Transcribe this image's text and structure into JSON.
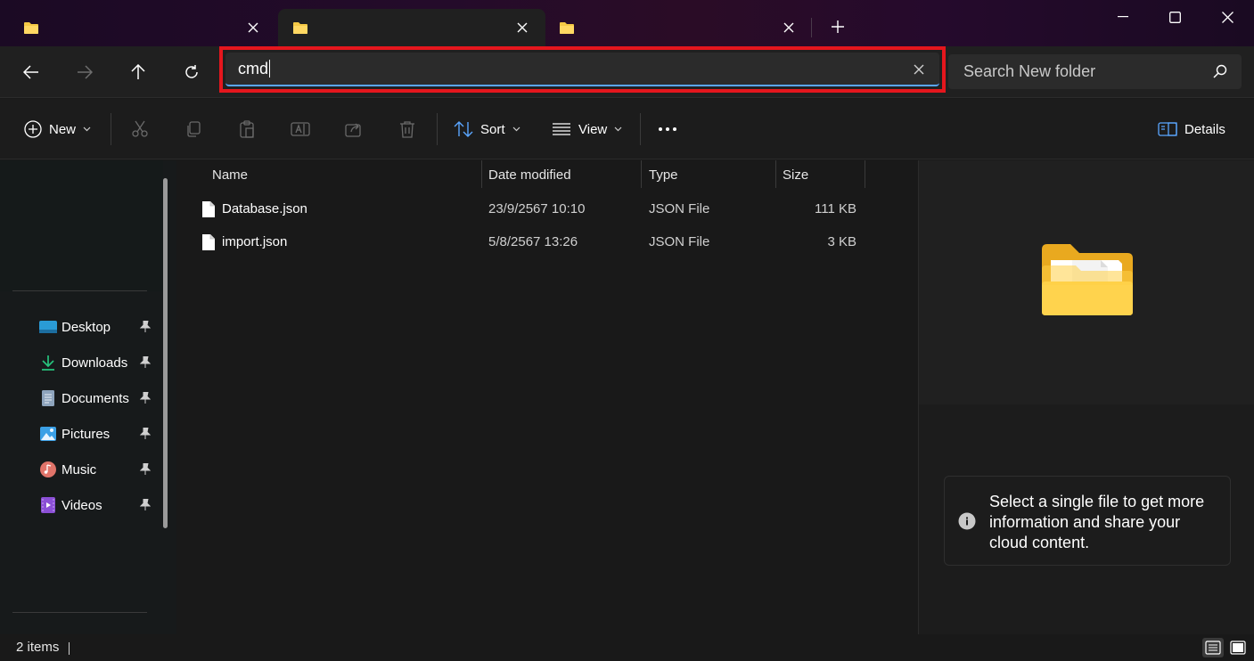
{
  "tabs": [
    {
      "icon": "folder-icon",
      "label": ""
    },
    {
      "icon": "folder-icon",
      "label": ""
    },
    {
      "icon": "folder-icon",
      "label": ""
    }
  ],
  "address": {
    "value": "cmd"
  },
  "search": {
    "placeholder": "Search New folder"
  },
  "toolbar": {
    "new_label": "New",
    "sort_label": "Sort",
    "view_label": "View",
    "details_label": "Details"
  },
  "sidebar": {
    "items": [
      {
        "label": "Desktop",
        "icon": "desktop-icon"
      },
      {
        "label": "Downloads",
        "icon": "downloads-icon"
      },
      {
        "label": "Documents",
        "icon": "documents-icon"
      },
      {
        "label": "Pictures",
        "icon": "pictures-icon"
      },
      {
        "label": "Music",
        "icon": "music-icon"
      },
      {
        "label": "Videos",
        "icon": "videos-icon"
      }
    ]
  },
  "columns": {
    "name": "Name",
    "date": "Date modified",
    "type": "Type",
    "size": "Size"
  },
  "files": [
    {
      "name": "Database.json",
      "date": "23/9/2567 10:10",
      "type": "JSON File",
      "size": "111 KB"
    },
    {
      "name": "import.json",
      "date": "5/8/2567 13:26",
      "type": "JSON File",
      "size": "3 KB"
    }
  ],
  "details": {
    "message": "Select a single file to get more information and share your cloud content."
  },
  "status": {
    "count": "2 items"
  },
  "colors": {
    "accent": "#5aa6ff",
    "highlight": "#e5161d",
    "folder": "#f5c945"
  }
}
